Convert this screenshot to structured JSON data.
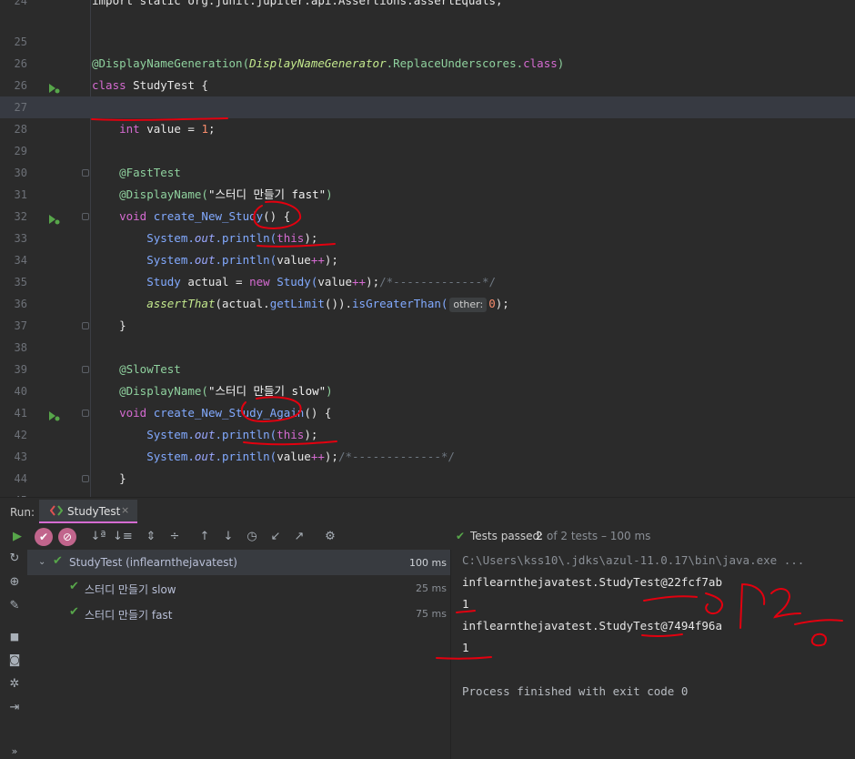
{
  "editor": {
    "lines": [
      {
        "num": "24",
        "tokens": [
          {
            "t": "import static org.junit.jupiter.api.Assertions.assertEquals;",
            "c": "t-plain"
          }
        ]
      },
      {
        "num": "25",
        "tokens": []
      },
      {
        "num": "26",
        "tokens": [
          {
            "t": "@DisplayNameGeneration(",
            "c": "t-ann"
          },
          {
            "t": "DisplayNameGenerator",
            "c": "t-ital"
          },
          {
            "t": ".ReplaceUnderscores.",
            "c": "t-ann"
          },
          {
            "t": "class",
            "c": "t-kw"
          },
          {
            "t": ")",
            "c": "t-ann"
          }
        ]
      },
      {
        "num": "26",
        "tokens": [
          {
            "t": "class ",
            "c": "t-kw"
          },
          {
            "t": "StudyTest {",
            "c": "t-plain"
          }
        ]
      },
      {
        "num": "27",
        "tokens": []
      },
      {
        "num": "28",
        "tokens": [
          {
            "t": "    int ",
            "c": "t-kw"
          },
          {
            "t": "value = ",
            "c": "t-plain"
          },
          {
            "t": "1",
            "c": "t-num"
          },
          {
            "t": ";",
            "c": "t-plain"
          }
        ]
      },
      {
        "num": "29",
        "tokens": []
      },
      {
        "num": "30",
        "tokens": [
          {
            "t": "    @FastTest",
            "c": "t-ann"
          }
        ]
      },
      {
        "num": "31",
        "tokens": [
          {
            "t": "    @DisplayName(",
            "c": "t-ann"
          },
          {
            "t": "\"스터디 만들기 fast\"",
            "c": "t-str"
          },
          {
            "t": ")",
            "c": "t-ann"
          }
        ]
      },
      {
        "num": "32",
        "tokens": [
          {
            "t": "    void ",
            "c": "t-kw"
          },
          {
            "t": "create_New_Study",
            "c": "t-meth"
          },
          {
            "t": "() {",
            "c": "t-plain"
          }
        ]
      },
      {
        "num": "33",
        "tokens": [
          {
            "t": "        System.",
            "c": "t-meth"
          },
          {
            "t": "out",
            "c": "t-field"
          },
          {
            "t": ".println(",
            "c": "t-meth"
          },
          {
            "t": "this",
            "c": "t-kw"
          },
          {
            "t": ");",
            "c": "t-plain"
          }
        ]
      },
      {
        "num": "34",
        "tokens": [
          {
            "t": "        System.",
            "c": "t-meth"
          },
          {
            "t": "out",
            "c": "t-field"
          },
          {
            "t": ".println(",
            "c": "t-meth"
          },
          {
            "t": "value",
            "c": "t-plain"
          },
          {
            "t": "++",
            "c": "t-kw"
          },
          {
            "t": ");",
            "c": "t-plain"
          }
        ]
      },
      {
        "num": "35",
        "tokens": [
          {
            "t": "        Study ",
            "c": "t-meth"
          },
          {
            "t": "actual = ",
            "c": "t-plain"
          },
          {
            "t": "new ",
            "c": "t-kw"
          },
          {
            "t": "Study(",
            "c": "t-meth"
          },
          {
            "t": "value",
            "c": "t-plain"
          },
          {
            "t": "++",
            "c": "t-kw"
          },
          {
            "t": ");",
            "c": "t-plain"
          },
          {
            "t": "/*-------------*/",
            "c": "t-cmt"
          }
        ]
      },
      {
        "num": "36",
        "tokens": [
          {
            "t": "        ",
            "c": "t-plain"
          },
          {
            "t": "assertThat",
            "c": "t-static"
          },
          {
            "t": "(actual.",
            "c": "t-plain"
          },
          {
            "t": "getLimit",
            "c": "t-meth"
          },
          {
            "t": "()).",
            "c": "t-plain"
          },
          {
            "t": "isGreaterThan(",
            "c": "t-meth"
          },
          {
            "t": "other:",
            "c": "hint"
          },
          {
            "t": "0",
            "c": "t-num"
          },
          {
            "t": ");",
            "c": "t-plain"
          }
        ]
      },
      {
        "num": "37",
        "tokens": [
          {
            "t": "    }",
            "c": "t-plain"
          }
        ]
      },
      {
        "num": "38",
        "tokens": []
      },
      {
        "num": "39",
        "tokens": [
          {
            "t": "    @SlowTest",
            "c": "t-ann"
          }
        ]
      },
      {
        "num": "40",
        "tokens": [
          {
            "t": "    @DisplayName(",
            "c": "t-ann"
          },
          {
            "t": "\"스터디 만들기 slow\"",
            "c": "t-str"
          },
          {
            "t": ")",
            "c": "t-ann"
          }
        ]
      },
      {
        "num": "41",
        "tokens": [
          {
            "t": "    void ",
            "c": "t-kw"
          },
          {
            "t": "create_New_Study_Again",
            "c": "t-meth"
          },
          {
            "t": "() {",
            "c": "t-plain"
          }
        ]
      },
      {
        "num": "42",
        "tokens": [
          {
            "t": "        System.",
            "c": "t-meth"
          },
          {
            "t": "out",
            "c": "t-field"
          },
          {
            "t": ".println(",
            "c": "t-meth"
          },
          {
            "t": "this",
            "c": "t-kw"
          },
          {
            "t": ");",
            "c": "t-plain"
          }
        ]
      },
      {
        "num": "43",
        "tokens": [
          {
            "t": "        System.",
            "c": "t-meth"
          },
          {
            "t": "out",
            "c": "t-field"
          },
          {
            "t": ".println(",
            "c": "t-meth"
          },
          {
            "t": "value",
            "c": "t-plain"
          },
          {
            "t": "++",
            "c": "t-kw"
          },
          {
            "t": ");",
            "c": "t-plain"
          },
          {
            "t": "/*-------------*/",
            "c": "t-cmt"
          }
        ]
      },
      {
        "num": "44",
        "tokens": [
          {
            "t": "    }",
            "c": "t-plain"
          }
        ]
      },
      {
        "num": "45",
        "tokens": []
      }
    ]
  },
  "run_panel": {
    "label": "Run:",
    "tab_label": "StudyTest",
    "close_glyph": "×",
    "status_passed": "Tests passed:",
    "status_count": "2",
    "status_of": "of 2 tests – 100 ms",
    "tree": [
      {
        "name": "StudyTest (inflearnthejavatest)",
        "time": "100 ms"
      },
      {
        "name": "스터디 만들기 slow",
        "time": "25 ms"
      },
      {
        "name": "스터디 만들기 fast",
        "time": "75 ms"
      }
    ],
    "console": [
      "C:\\Users\\kss10\\.jdks\\azul-11.0.17\\bin\\java.exe ...",
      "inflearnthejavatest.StudyTest@22fcf7ab",
      "1",
      "inflearnthejavatest.StudyTest@7494f96a",
      "1",
      "",
      "Process finished with exit code 0"
    ],
    "more_glyph": "»"
  },
  "colors": {
    "background": "#2b2b2b",
    "accent_pink": "#d56bd1",
    "pass_green": "#57a64a",
    "annotation_red": "#e3000f"
  },
  "icons": [
    "run-icon",
    "check-icon",
    "stop-icon",
    "sort-alpha-icon",
    "sort-duration-icon",
    "expand-all-icon",
    "collapse-all-icon",
    "up-arrow-icon",
    "down-arrow-icon",
    "history-icon",
    "import-icon",
    "export-icon",
    "settings-icon",
    "rerun-icon",
    "debug-icon",
    "wrench-icon",
    "camera-icon",
    "gear-icon",
    "login-icon"
  ]
}
